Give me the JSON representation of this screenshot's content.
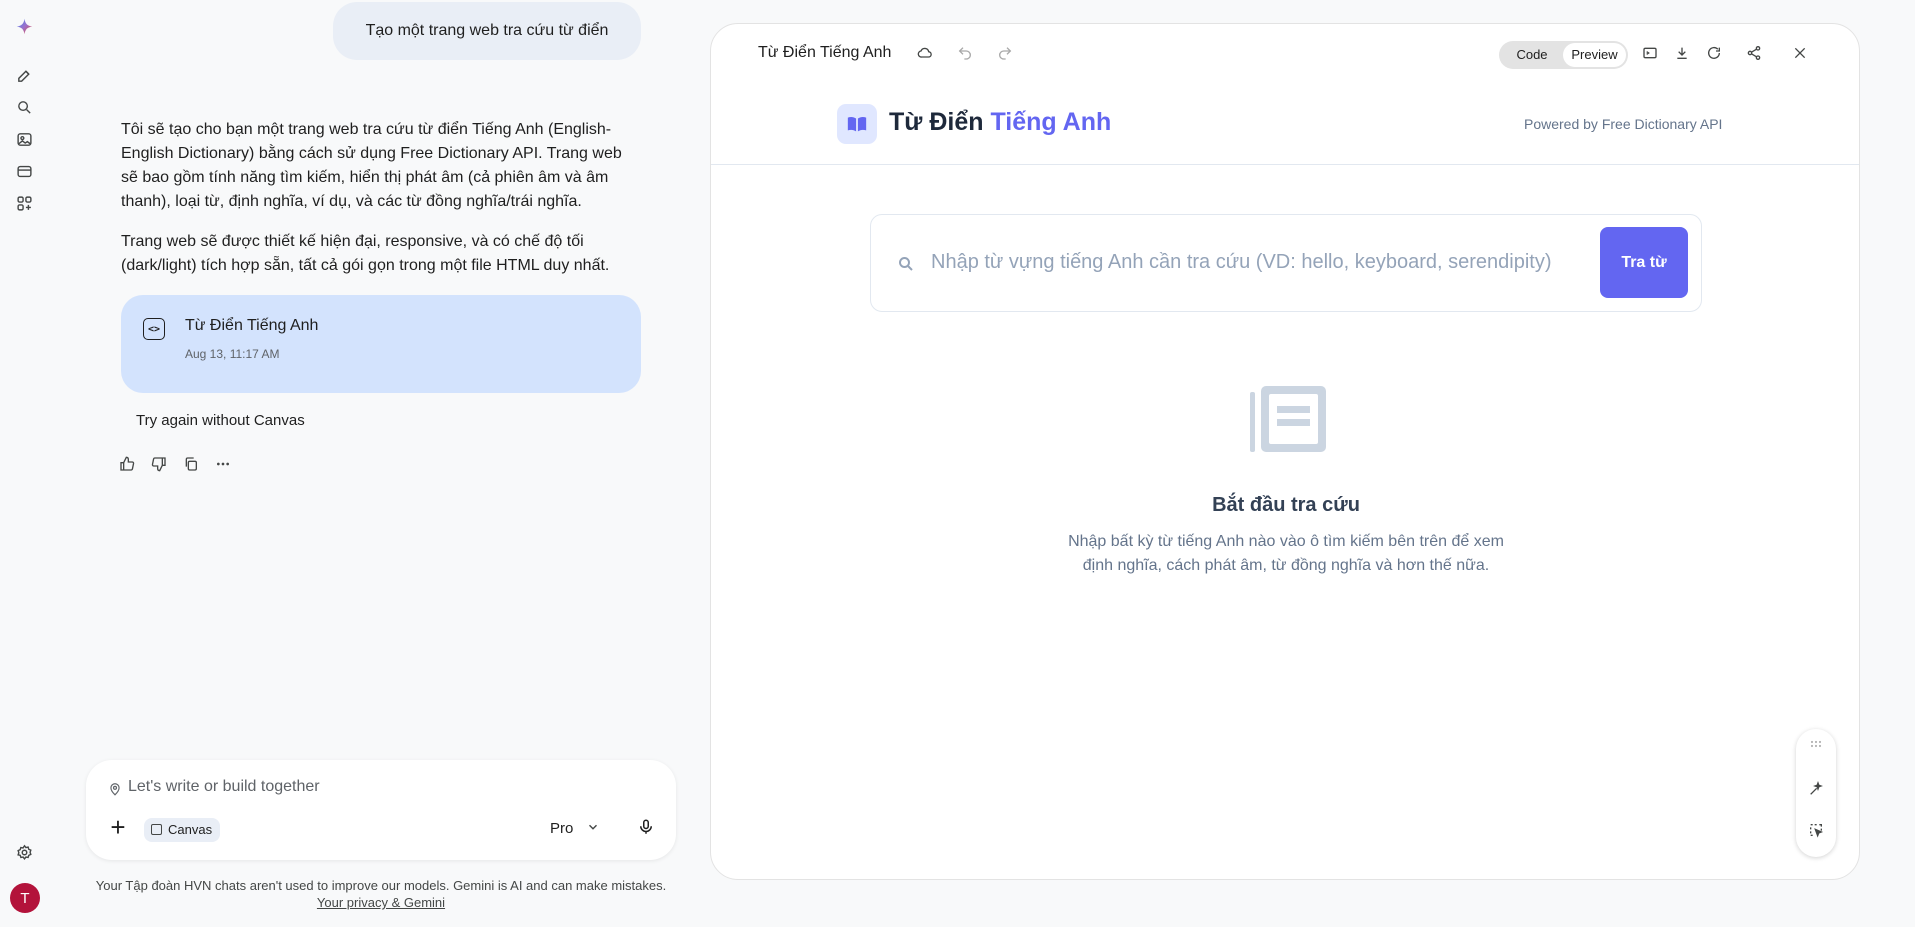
{
  "chat": {
    "user_message": "Tạo một trang web tra cứu từ điển",
    "answer_paragraphs": [
      "Tôi sẽ tạo cho bạn một trang web tra cứu từ điển Tiếng Anh (English-English Dictionary) bằng cách sử dụng Free Dictionary API. Trang web sẽ bao gồm tính năng tìm kiếm, hiển thị phát âm (cả phiên âm và âm thanh), loại từ, định nghĩa, ví dụ, và các từ đồng nghĩa/trái nghĩa.",
      "Trang web sẽ được thiết kế hiện đại, responsive, và có chế độ tối (dark/light) tích hợp sẵn, tất cả gói gọn trong một file HTML duy nhất."
    ],
    "canvas_card": {
      "title": "Từ Điển Tiếng Anh",
      "date": "Aug 13, 11:17 AM"
    },
    "try_again": "Try again without Canvas"
  },
  "input": {
    "placeholder": "Let's write or build together",
    "canvas_chip": "Canvas",
    "model": "Pro"
  },
  "disclaimer": {
    "text": "Your Tập đoàn HVN chats aren't used to improve our models. Gemini is AI and can make mistakes.",
    "link": "Your privacy & Gemini"
  },
  "avatar_letter": "T",
  "panel": {
    "title": "Từ Điển Tiếng Anh",
    "tabs": {
      "code": "Code",
      "preview": "Preview",
      "active": "Preview"
    }
  },
  "app": {
    "brand_main": "Từ Điển",
    "brand_accent": "Tiếng Anh",
    "powered_by": "Powered by Free Dictionary API",
    "search_placeholder": "Nhập từ vựng tiếng Anh cần tra cứu (VD: hello, keyboard, serendipity)",
    "search_button": "Tra từ",
    "empty_title": "Bắt đầu tra cứu",
    "empty_desc": "Nhập bất kỳ từ tiếng Anh nào vào ô tìm kiếm bên trên để xem định nghĩa, cách phát âm, từ đồng nghĩa và hơn thế nữa."
  },
  "colors": {
    "accent": "#6366f1",
    "accent_light": "#e0e7ff",
    "canvas_card_bg": "#d3e3fd",
    "avatar_bg": "#b3133b"
  },
  "icons": {
    "rail": [
      "gemini-star-icon",
      "new-chat-icon",
      "search-icon",
      "gallery-icon",
      "canvas-icon",
      "apps-icon",
      "settings-icon"
    ],
    "actions": [
      "thumbs-up-icon",
      "thumbs-down-icon",
      "copy-icon",
      "more-icon"
    ]
  }
}
